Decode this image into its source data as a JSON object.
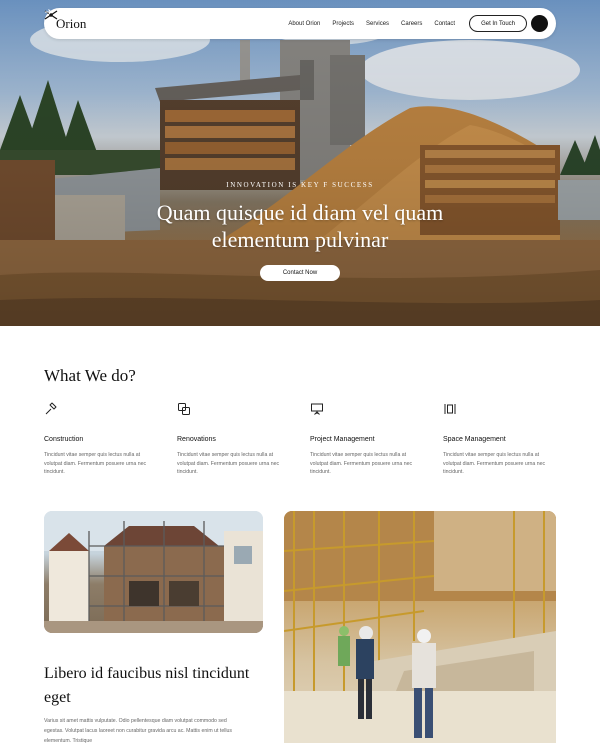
{
  "brand": {
    "name": "Orion"
  },
  "nav": {
    "links": [
      "About Orion",
      "Projects",
      "Services",
      "Careers",
      "Contact"
    ],
    "cta_label": "Get In Touch"
  },
  "hero": {
    "eyebrow": "INNOVATION IS KEY F SUCCESS",
    "title_line1": "Quam quisque id diam vel quam",
    "title_line2": "elementum pulvinar",
    "button_label": "Contact Now"
  },
  "services_section": {
    "title": "What We do?",
    "items": [
      {
        "icon": "hammer-icon",
        "title": "Construction",
        "desc": "Tincidunt vitae semper quis lectus nulla at volutpat diam. Fermentum posuere urna nec tincidunt."
      },
      {
        "icon": "renovation-icon",
        "title": "Renovations",
        "desc": "Tincidunt vitae semper quis lectus nulla at volutpat diam. Fermentum posuere urna nec tincidunt."
      },
      {
        "icon": "presentation-board-icon",
        "title": "Project Management",
        "desc": "Tincidunt vitae semper quis lectus nulla at volutpat diam. Fermentum posuere urna nec tincidunt."
      },
      {
        "icon": "space-icon",
        "title": "Space Management",
        "desc": "Tincidunt vitae semper quis lectus nulla at volutpat diam. Fermentum posuere urna nec tincidunt."
      }
    ]
  },
  "feature": {
    "title": "Libero id faucibus nisl tincidunt eget",
    "desc": "Varius sit amet mattis vulputate. Odio pellentesque diam volutpat commodo sed egestas. Volutpat lacus laoreet non curabitur gravida arcu ac. Mattis enim ut tellus elementum. Tristique"
  },
  "colors": {
    "accent_dark": "#111111",
    "text_muted": "#666666",
    "background": "#ffffff"
  }
}
